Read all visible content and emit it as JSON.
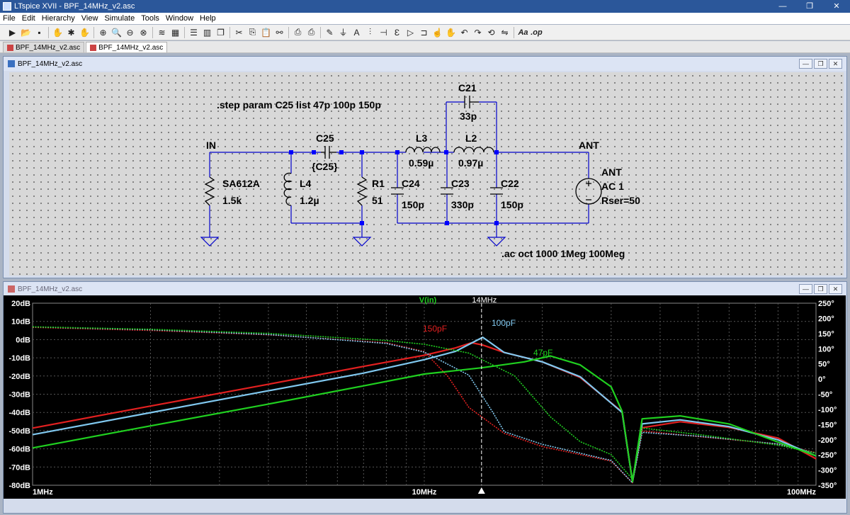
{
  "app": {
    "title": "LTspice XVII - BPF_14MHz_v2.asc",
    "window_buttons": [
      "—",
      "❐",
      "✕"
    ]
  },
  "menu": [
    "File",
    "Edit",
    "Hierarchy",
    "View",
    "Simulate",
    "Tools",
    "Window",
    "Help"
  ],
  "toolbar": {
    "groups": [
      [
        "run-icon",
        "open-icon",
        "save-icon"
      ],
      [
        "halt-icon",
        "run-man-icon",
        "pan-icon"
      ],
      [
        "zoom-in-icon",
        "zoom-area-icon",
        "zoom-out-icon",
        "zoom-cancel-icon"
      ],
      [
        "autorange-icon",
        "plot-grid-icon"
      ],
      [
        "tile-h-icon",
        "tile-v-icon",
        "cascade-icon"
      ],
      [
        "cut-icon",
        "copy-icon",
        "paste-icon",
        "find-icon"
      ],
      [
        "print-icon",
        "print-setup-icon"
      ],
      [
        "draw-wire-icon",
        "ground-icon",
        "label-net-icon",
        "resistor-icon",
        "capacitor-icon",
        "inductor-icon",
        "diode-icon",
        "component-icon",
        "move-icon",
        "drag-icon",
        "undo-icon",
        "redo-icon",
        "rotate-icon",
        "mirror-icon"
      ]
    ],
    "text_tools": [
      "Aa",
      ".op"
    ]
  },
  "tabs": [
    "BPF_14MHz_v2.asc",
    "BPF_14MHz_v2.asc"
  ],
  "schematic_window": {
    "title": "BPF_14MHz_v2.asc",
    "labels": {
      "step_directive": ".step param C25 list 47p 100p 150p",
      "ac_directive": ".ac oct 1000 1Meg 100Meg",
      "net_in": "IN",
      "net_ant": "ANT",
      "c25_name": "C25",
      "c25_value": "{C25}",
      "c21_name": "C21",
      "c21_value": "33p",
      "l3_name": "L3",
      "l3_value": "0.59µ",
      "l2_name": "L2",
      "l2_value": "0.97µ",
      "r_sa_name": "SA612A",
      "r_sa_value": "1.5k",
      "l4_name": "L4",
      "l4_value": "1.2µ",
      "r1_name": "R1",
      "r1_value": "51",
      "c24_name": "C24",
      "c24_value": "150p",
      "c23_name": "C23",
      "c23_value": "330p",
      "c22_name": "C22",
      "c22_value": "150p",
      "src_name": "ANT",
      "src_ac": "AC 1",
      "src_rser": "Rser=50"
    }
  },
  "plot_window": {
    "title": "BPF_14MHz_v2.asc",
    "trace_name": "V(in)",
    "cursor_label": "14MHz",
    "series_labels": [
      "150pF",
      "100pF",
      "47pF"
    ]
  },
  "colors": {
    "series_150pF": "#e22020",
    "series_100pF": "#80c8ef",
    "series_47pF": "#20d020",
    "trace_name": "#20d020",
    "axis_text": "#ffffff",
    "grid": "#555555",
    "titlebar": "#2b579a",
    "schematic_wire": "#0000cc",
    "schematic_node": "#0000ff"
  },
  "chart_data": {
    "type": "line",
    "title": "",
    "x_scale": "log",
    "xlim": [
      1,
      100
    ],
    "x_ticks": [
      1,
      10,
      100
    ],
    "x_tick_labels": [
      "1MHz",
      "10MHz",
      "100MHz"
    ],
    "xlabel": "",
    "ylabel_left": "",
    "ylabel_right": "",
    "ylim_left": [
      -80,
      20
    ],
    "y_ticks_left": [
      20,
      10,
      0,
      -10,
      -20,
      -30,
      -40,
      -50,
      -60,
      -70,
      -80
    ],
    "y_tick_labels_left": [
      "20dB",
      "10dB",
      "0dB",
      "-10dB",
      "-20dB",
      "-30dB",
      "-40dB",
      "-50dB",
      "-60dB",
      "-70dB",
      "-80dB"
    ],
    "ylim_right": [
      -350,
      250
    ],
    "y_ticks_right": [
      250,
      200,
      150,
      100,
      50,
      0,
      -50,
      -100,
      -150,
      -200,
      -250,
      -300,
      -350
    ],
    "y_tick_labels_right": [
      "250°",
      "200°",
      "150°",
      "100°",
      "50°",
      "0°",
      "-50°",
      "-100°",
      "-150°",
      "-200°",
      "-250°",
      "-300°",
      "-350°"
    ],
    "grid": true,
    "cursor_x": 14,
    "series": [
      {
        "name": "150pF",
        "magnitude_db": [
          [
            1,
            -48.6
          ],
          [
            2,
            -36.5
          ],
          [
            4,
            -24.5
          ],
          [
            7,
            -14.7
          ],
          [
            10,
            -8.6
          ],
          [
            12,
            -4.6
          ],
          [
            13.2,
            -1.7
          ],
          [
            14.1,
            -3.0
          ],
          [
            16,
            -7.1
          ],
          [
            20,
            -12.2
          ],
          [
            25,
            -20.8
          ],
          [
            32,
            -39.7
          ],
          [
            34,
            -78
          ],
          [
            36,
            -48.4
          ],
          [
            45,
            -45.1
          ],
          [
            60,
            -48.2
          ],
          [
            80,
            -54.1
          ],
          [
            100,
            -65.5
          ]
        ],
        "phase_deg": [
          [
            1,
            170.5
          ],
          [
            2,
            160.1
          ],
          [
            4,
            145.8
          ],
          [
            8,
            119.8
          ],
          [
            10,
            90.6
          ],
          [
            11.5,
            8.0
          ],
          [
            13,
            -93.6
          ],
          [
            16,
            -179.0
          ],
          [
            20,
            -222.5
          ],
          [
            30,
            -270.3
          ],
          [
            34,
            -342
          ],
          [
            36,
            -170.9
          ],
          [
            50,
            -189.4
          ],
          [
            80,
            -214.1
          ],
          [
            100,
            -242.6
          ]
        ]
      },
      {
        "name": "100pF",
        "magnitude_db": [
          [
            1,
            -52.2
          ],
          [
            2,
            -40.1
          ],
          [
            4,
            -28.1
          ],
          [
            7,
            -18.4
          ],
          [
            10,
            -11.0
          ],
          [
            12,
            -6.5
          ],
          [
            14.1,
            1.3
          ],
          [
            16,
            -7.1
          ],
          [
            20,
            -12.2
          ],
          [
            25,
            -20.4
          ],
          [
            32,
            -40.0
          ],
          [
            34,
            -78
          ],
          [
            36,
            -46.3
          ],
          [
            45,
            -44.1
          ],
          [
            60,
            -47.8
          ],
          [
            80,
            -55.1
          ],
          [
            100,
            -63.9
          ]
        ],
        "phase_deg": [
          [
            1,
            171.9
          ],
          [
            2,
            162.5
          ],
          [
            4,
            146.7
          ],
          [
            8,
            117.3
          ],
          [
            10,
            88.6
          ],
          [
            13,
            12.8
          ],
          [
            15,
            -112.3
          ],
          [
            16,
            -173.6
          ],
          [
            20,
            -215.1
          ],
          [
            30,
            -268.4
          ],
          [
            34,
            -342
          ],
          [
            36,
            -175.9
          ],
          [
            50,
            -188.3
          ],
          [
            80,
            -213.8
          ],
          [
            100,
            -244.2
          ]
        ]
      },
      {
        "name": "47pF",
        "magnitude_db": [
          [
            1,
            -59.5
          ],
          [
            2,
            -47.4
          ],
          [
            4,
            -35.4
          ],
          [
            7,
            -25.4
          ],
          [
            10,
            -18.9
          ],
          [
            14,
            -15.5
          ],
          [
            18,
            -12.2
          ],
          [
            21,
            -9.0
          ],
          [
            25,
            -13.9
          ],
          [
            30,
            -25.9
          ],
          [
            32,
            -39.4
          ],
          [
            34,
            -78
          ],
          [
            36,
            -43.5
          ],
          [
            45,
            -41.9
          ],
          [
            60,
            -46.3
          ],
          [
            80,
            -56.3
          ],
          [
            100,
            -63.8
          ]
        ],
        "phase_deg": [
          [
            1,
            172.2
          ],
          [
            2,
            164.1
          ],
          [
            4,
            150.5
          ],
          [
            8,
            127.0
          ],
          [
            10,
            114.5
          ],
          [
            13,
            85.5
          ],
          [
            17,
            10.6
          ],
          [
            21,
            -125.0
          ],
          [
            25,
            -206.5
          ],
          [
            30,
            -248.6
          ],
          [
            34,
            -330
          ],
          [
            36,
            -161.4
          ],
          [
            50,
            -182.6
          ],
          [
            80,
            -217.8
          ],
          [
            100,
            -244.2
          ]
        ]
      }
    ]
  }
}
